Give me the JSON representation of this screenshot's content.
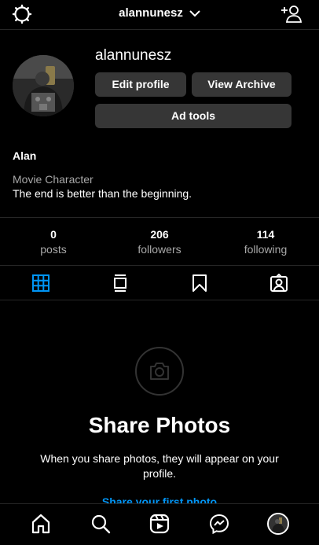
{
  "header": {
    "username": "alannunesz",
    "settings_icon": "settings-icon",
    "dropdown_icon": "chevron-down-icon",
    "add_user_icon": "add-person-icon"
  },
  "profile": {
    "username": "alannunesz",
    "edit_profile_label": "Edit profile",
    "view_archive_label": "View Archive",
    "ad_tools_label": "Ad tools",
    "name": "Alan",
    "category": "Movie Character",
    "bio": "The end is better than the beginning."
  },
  "stats": [
    {
      "value": "0",
      "label": "posts"
    },
    {
      "value": "206",
      "label": "followers"
    },
    {
      "value": "114",
      "label": "following"
    }
  ],
  "tabs": [
    {
      "icon": "grid-icon",
      "active": true
    },
    {
      "icon": "feed-icon",
      "active": false
    },
    {
      "icon": "bookmark-icon",
      "active": false
    },
    {
      "icon": "tagged-icon",
      "active": false
    }
  ],
  "empty_state": {
    "title": "Share Photos",
    "description": "When you share photos, they will appear on your profile.",
    "link": "Share your first photo"
  },
  "bottom_nav": [
    "home-icon",
    "search-icon",
    "reels-icon",
    "messenger-icon",
    "profile-avatar"
  ],
  "colors": {
    "background": "#000000",
    "button": "#363636",
    "active_tab": "#0095f6",
    "link": "#0095f6",
    "muted_text": "#a8a8a8"
  }
}
